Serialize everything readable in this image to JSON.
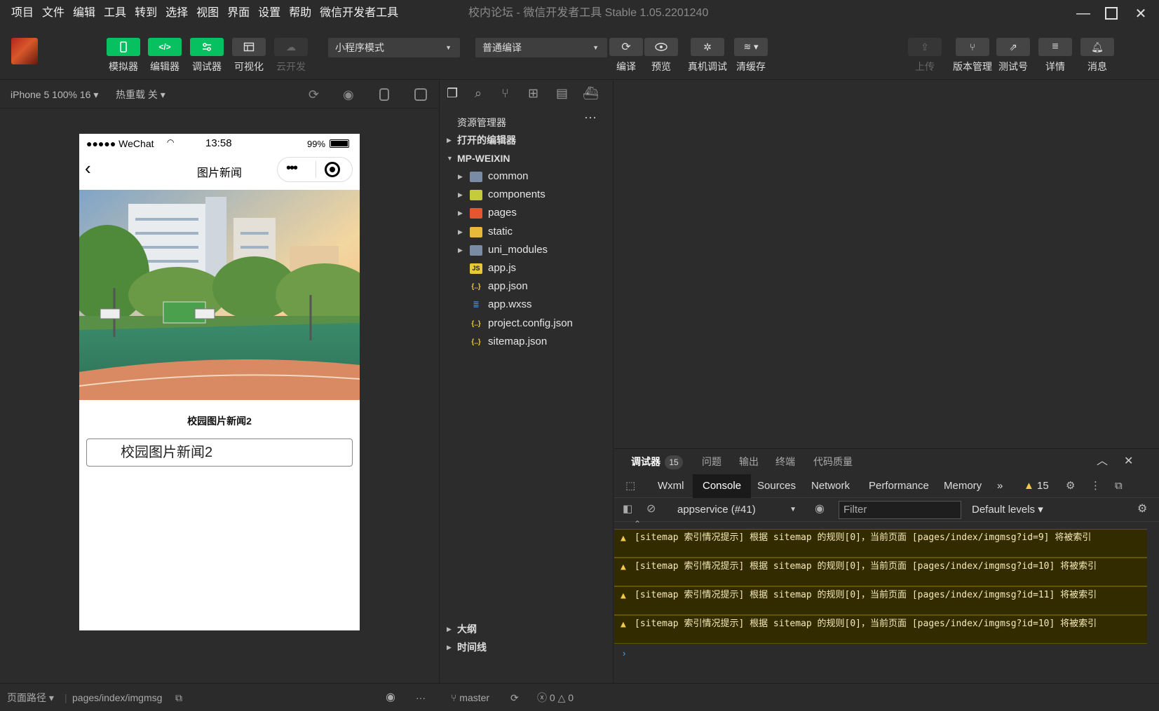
{
  "menu": [
    "项目",
    "文件",
    "编辑",
    "工具",
    "转到",
    "选择",
    "视图",
    "界面",
    "设置",
    "帮助",
    "微信开发者工具"
  ],
  "window_title": "校内论坛 - 微信开发者工具 Stable 1.05.2201240",
  "toolbar": {
    "simulator": "模拟器",
    "editor": "编辑器",
    "debugger": "调试器",
    "visual": "可视化",
    "cloud": "云开发",
    "mode_select": "小程序模式",
    "compile_select": "普通编译",
    "compile": "编译",
    "preview": "预览",
    "real_debug": "真机调试",
    "clear_cache": "清缓存",
    "upload": "上传",
    "version": "版本管理",
    "test_account": "测试号",
    "details": "详情",
    "messages": "消息"
  },
  "simulator": {
    "device": "iPhone 5 100% 16",
    "hot_reload": "热重载 关"
  },
  "phone": {
    "carrier": "●●●●● WeChat",
    "time": "13:58",
    "battery": "99%",
    "page_title": "图片新闻",
    "news_title": "校园图片新闻2",
    "news_box": "校园图片新闻2"
  },
  "explorer": {
    "title": "资源管理器",
    "open_editors": "打开的编辑器",
    "project": "MP-WEIXIN",
    "items": [
      {
        "name": "common",
        "icon": "folder-icon",
        "color": "#7a8ca5",
        "expandable": true
      },
      {
        "name": "components",
        "icon": "folder-components-icon",
        "color": "#c4cc3a",
        "expandable": true
      },
      {
        "name": "pages",
        "icon": "folder-pages-icon",
        "color": "#e2572f",
        "expandable": true
      },
      {
        "name": "static",
        "icon": "folder-static-icon",
        "color": "#e8b83a",
        "expandable": true
      },
      {
        "name": "uni_modules",
        "icon": "folder-icon",
        "color": "#7a8ca5",
        "expandable": true
      },
      {
        "name": "app.js",
        "icon": "js-file-icon",
        "color": "#e8c73a",
        "expandable": false
      },
      {
        "name": "app.json",
        "icon": "json-file-icon",
        "color": "#e8c73a",
        "expandable": false
      },
      {
        "name": "app.wxss",
        "icon": "css-file-icon",
        "color": "#3a8fe8",
        "expandable": false
      },
      {
        "name": "project.config.json",
        "icon": "json-file-icon",
        "color": "#e8c73a",
        "expandable": false
      },
      {
        "name": "sitemap.json",
        "icon": "json-file-icon",
        "color": "#e8c73a",
        "expandable": false
      }
    ],
    "outline": "大纲",
    "timeline": "时间线"
  },
  "debug": {
    "tabs": [
      "调试器",
      "问题",
      "输出",
      "终端",
      "代码质量"
    ],
    "badge": "15",
    "devtools_tabs": [
      "Wxml",
      "Console",
      "Sources",
      "Network",
      "Performance",
      "Memory"
    ],
    "warning_count": "15",
    "context": "appservice (#41)",
    "filter_placeholder": "Filter",
    "levels": "Default levels",
    "messages": [
      "[sitemap 索引情况提示] 根据 sitemap 的规则[0]，当前页面 [pages/index/imgmsg?id=9] 将被索引",
      "[sitemap 索引情况提示] 根据 sitemap 的规则[0]，当前页面 [pages/index/imgmsg?id=10] 将被索引",
      "[sitemap 索引情况提示] 根据 sitemap 的规则[0]，当前页面 [pages/index/imgmsg?id=11] 将被索引",
      "[sitemap 索引情况提示] 根据 sitemap 的规则[0]，当前页面 [pages/index/imgmsg?id=10] 将被索引"
    ]
  },
  "statusbar": {
    "page_path_label": "页面路径",
    "page_path": "pages/index/imgmsg",
    "branch": "master",
    "errors": "0",
    "warnings": "0"
  },
  "colors": {
    "accent": "#07c160",
    "background": "#2c2c2c",
    "warning_bg": "#332b00"
  }
}
